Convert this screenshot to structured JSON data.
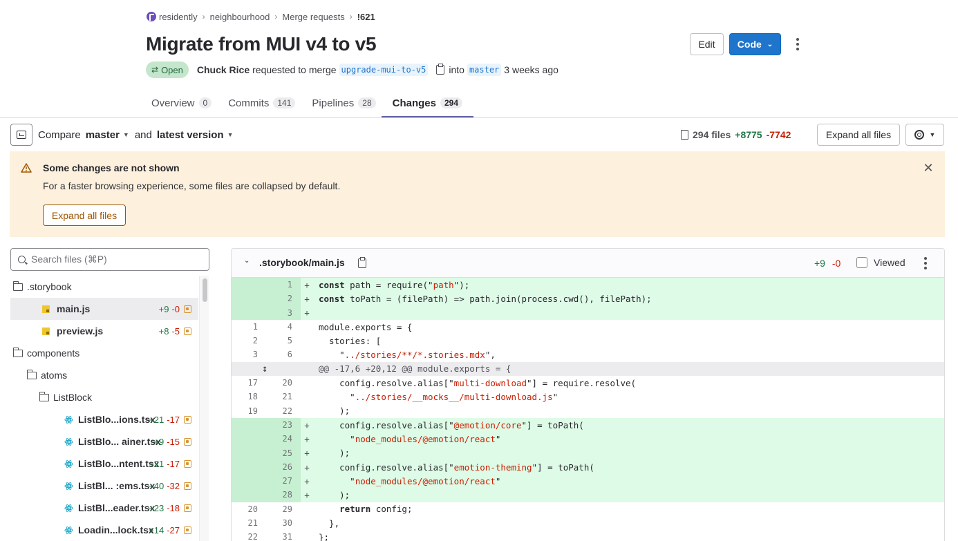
{
  "breadcrumb": {
    "group": "residently",
    "project": "neighbourhood",
    "section": "Merge requests",
    "current": "!621"
  },
  "title": "Migrate from MUI v4 to v5",
  "actions": {
    "edit": "Edit",
    "code": "Code"
  },
  "meta": {
    "status": "Open",
    "author": "Chuck Rice",
    "requested": "requested to merge",
    "source_branch": "upgrade-mui-to-v5",
    "into": "into",
    "target_branch": "master",
    "time": "3 weeks ago"
  },
  "tabs": [
    {
      "label": "Overview",
      "count": "0"
    },
    {
      "label": "Commits",
      "count": "141"
    },
    {
      "label": "Pipelines",
      "count": "28"
    },
    {
      "label": "Changes",
      "count": "294"
    }
  ],
  "compare": {
    "label": "Compare",
    "base": "master",
    "and": "and",
    "version": "latest version"
  },
  "stats": {
    "files": "294 files",
    "added": "+8775",
    "removed": "-7742"
  },
  "expand_all": "Expand all files",
  "alert": {
    "title": "Some changes are not shown",
    "text": "For a faster browsing experience, some files are collapsed by default.",
    "button": "Expand all files"
  },
  "search": {
    "placeholder": "Search files (⌘P)"
  },
  "tree": [
    {
      "name": ".storybook",
      "type": "folder",
      "depth": 0
    },
    {
      "name": "main.js",
      "type": "js",
      "depth": 1,
      "added": "+9",
      "removed": "-0",
      "active": true
    },
    {
      "name": "preview.js",
      "type": "js",
      "depth": 1,
      "added": "+8",
      "removed": "-5"
    },
    {
      "name": "components",
      "type": "folder",
      "depth": 0
    },
    {
      "name": "atoms",
      "type": "folder",
      "depth": 1
    },
    {
      "name": "ListBlock",
      "type": "folder",
      "depth": 2
    },
    {
      "name": "ListBlo...ions.tsx",
      "type": "react",
      "depth": 3,
      "added": "+21",
      "removed": "-17"
    },
    {
      "name": "ListBlo... ainer.tsx",
      "type": "react",
      "depth": 3,
      "added": "+9",
      "removed": "-15"
    },
    {
      "name": "ListBlo...ntent.tsx",
      "type": "react",
      "depth": 3,
      "added": "+21",
      "removed": "-17"
    },
    {
      "name": "ListBl... :ems.tsx",
      "type": "react",
      "depth": 3,
      "added": "+40",
      "removed": "-32"
    },
    {
      "name": "ListBl...eader.tsx",
      "type": "react",
      "depth": 3,
      "added": "+23",
      "removed": "-18"
    },
    {
      "name": "Loadin...lock.tsx",
      "type": "react",
      "depth": 3,
      "added": "+14",
      "removed": "-27"
    }
  ],
  "diff": {
    "file": ".storybook/main.js",
    "added": "+9",
    "removed": "-0",
    "viewed": "Viewed",
    "lines": [
      {
        "kind": "add",
        "old": "",
        "new": "1",
        "code": "const path = require(\"path\");"
      },
      {
        "kind": "add",
        "old": "",
        "new": "2",
        "code": "const toPath = (filePath) => path.join(process.cwd(), filePath);"
      },
      {
        "kind": "add",
        "old": "",
        "new": "3",
        "code": ""
      },
      {
        "kind": "ctx",
        "old": "1",
        "new": "4",
        "code": "module.exports = {"
      },
      {
        "kind": "ctx",
        "old": "2",
        "new": "5",
        "code": "  stories: ["
      },
      {
        "kind": "ctx",
        "old": "3",
        "new": "6",
        "code": "    \"../stories/**/*.stories.mdx\","
      },
      {
        "kind": "hunk",
        "old": "",
        "new": "",
        "code": "@@ -17,6 +20,12 @@ module.exports = {"
      },
      {
        "kind": "ctx",
        "old": "17",
        "new": "20",
        "code": "    config.resolve.alias[\"multi-download\"] = require.resolve("
      },
      {
        "kind": "ctx",
        "old": "18",
        "new": "21",
        "code": "      \"../stories/__mocks__/multi-download.js\""
      },
      {
        "kind": "ctx",
        "old": "19",
        "new": "22",
        "code": "    );"
      },
      {
        "kind": "add",
        "old": "",
        "new": "23",
        "code": "    config.resolve.alias[\"@emotion/core\"] = toPath("
      },
      {
        "kind": "add",
        "old": "",
        "new": "24",
        "code": "      \"node_modules/@emotion/react\""
      },
      {
        "kind": "add",
        "old": "",
        "new": "25",
        "code": "    );"
      },
      {
        "kind": "add",
        "old": "",
        "new": "26",
        "code": "    config.resolve.alias[\"emotion-theming\"] = toPath("
      },
      {
        "kind": "add",
        "old": "",
        "new": "27",
        "code": "      \"node_modules/@emotion/react\""
      },
      {
        "kind": "add",
        "old": "",
        "new": "28",
        "code": "    );"
      },
      {
        "kind": "ctx",
        "old": "20",
        "new": "29",
        "code": "    return config;"
      },
      {
        "kind": "ctx",
        "old": "21",
        "new": "30",
        "code": "  },"
      },
      {
        "kind": "ctx",
        "old": "22",
        "new": "31",
        "code": "};"
      }
    ]
  }
}
